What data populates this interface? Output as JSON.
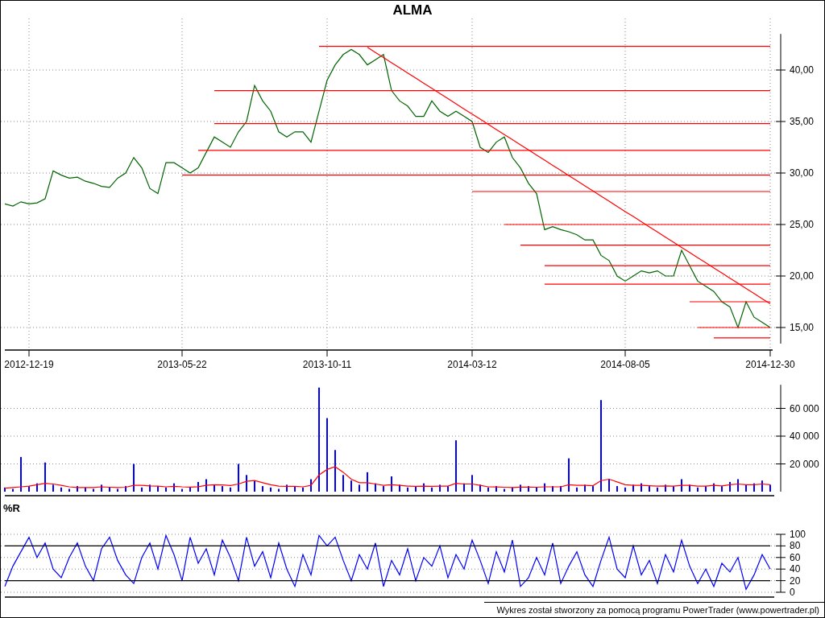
{
  "title": "ALMA",
  "price_chart": {
    "chart_data": {
      "type": "line",
      "categories": [
        null,
        null,
        null,
        "2012-12-19",
        null,
        null,
        null,
        null,
        null,
        null,
        null,
        null,
        null,
        null,
        null,
        null,
        null,
        null,
        null,
        null,
        null,
        null,
        "2013-05-22",
        null,
        null,
        null,
        null,
        null,
        null,
        null,
        null,
        null,
        null,
        null,
        null,
        null,
        null,
        null,
        null,
        null,
        "2013-10-11",
        null,
        null,
        null,
        null,
        null,
        null,
        null,
        null,
        null,
        null,
        null,
        null,
        null,
        null,
        null,
        null,
        null,
        "2014-03-12",
        null,
        null,
        null,
        null,
        null,
        null,
        null,
        null,
        null,
        null,
        null,
        null,
        null,
        null,
        null,
        null,
        null,
        null,
        "2014-08-05",
        null,
        null,
        null,
        null,
        null,
        null,
        null,
        null,
        null,
        null,
        null,
        null,
        null,
        null,
        null,
        null,
        null,
        "2014-12-30"
      ],
      "series": [
        {
          "color": "#006400",
          "values": [
            27,
            26.8,
            27.2,
            27,
            27.1,
            27.5,
            30.2,
            29.8,
            29.5,
            29.6,
            29.2,
            29,
            28.7,
            28.6,
            29.5,
            30,
            31.5,
            30.5,
            28.5,
            28,
            31,
            31,
            30.5,
            30,
            30.5,
            32,
            33.5,
            33,
            32.5,
            34,
            35,
            38.5,
            37,
            36,
            34,
            33.5,
            34,
            34,
            33,
            36,
            39,
            40.5,
            41.5,
            42,
            41.5,
            40.5,
            41,
            41.5,
            38,
            37,
            36.5,
            35.5,
            35.5,
            37,
            36,
            35.5,
            36,
            35.5,
            35,
            32.5,
            32,
            33,
            33.5,
            31.5,
            30.5,
            29,
            28,
            24.5,
            24.8,
            24.5,
            24.3,
            24,
            23.5,
            23.5,
            22,
            21.5,
            20,
            19.5,
            20,
            20.5,
            20.3,
            20.5,
            20,
            20,
            22.5,
            21,
            19.5,
            19,
            18.5,
            17.5,
            17,
            15,
            17.5,
            16,
            15.5,
            15
          ]
        },
        {
          "color": "#ff0000",
          "values": [
            null,
            null,
            null,
            null,
            null,
            null,
            null,
            null,
            null,
            null,
            null,
            null,
            null,
            null,
            null,
            null,
            null,
            null,
            null,
            null,
            null,
            null,
            null,
            null,
            null,
            null,
            null,
            null,
            null,
            null,
            null,
            null,
            null,
            null,
            null,
            null,
            null,
            null,
            null,
            42.3,
            42.3,
            42.3,
            42.3,
            42.3,
            42.3,
            42.3,
            42.3,
            42.3,
            42.3,
            42.3,
            42.3,
            42.3,
            42.3,
            42.3,
            42.3,
            42.3,
            42.3,
            42.3,
            42.3,
            42.3,
            42.3,
            42.3,
            42.3,
            42.3,
            42.3,
            42.3,
            42.3,
            42.3,
            42.3,
            42.3,
            42.3,
            42.3,
            42.3,
            42.3,
            42.3,
            42.3,
            42.3,
            42.3,
            42.3,
            42.3,
            42.3,
            42.3,
            42.3,
            42.3,
            42.3,
            42.3,
            42.3,
            42.3,
            42.3,
            42.3,
            42.3,
            42.3,
            42.3,
            42.3,
            42.3,
            42.3
          ]
        },
        {
          "color": "#ff0000",
          "values": [
            null,
            null,
            null,
            null,
            null,
            null,
            null,
            null,
            null,
            null,
            null,
            null,
            null,
            null,
            null,
            null,
            null,
            null,
            null,
            null,
            null,
            null,
            null,
            null,
            null,
            null,
            38,
            38,
            38,
            38,
            38,
            38,
            38,
            38,
            38,
            38,
            38,
            38,
            38,
            38,
            38,
            38,
            38,
            38,
            38,
            38,
            38,
            38,
            38,
            38,
            38,
            38,
            38,
            38,
            38,
            38,
            38,
            38,
            38,
            38,
            38,
            38,
            38,
            38,
            38,
            38,
            38,
            38,
            38,
            38,
            38,
            38,
            38,
            38,
            38,
            38,
            38,
            38,
            38,
            38,
            38,
            38,
            38,
            38,
            38,
            38,
            38,
            38,
            38,
            38,
            38,
            38,
            38,
            38,
            38,
            38
          ]
        },
        {
          "color": "#ff0000",
          "values": [
            null,
            null,
            null,
            null,
            null,
            null,
            null,
            null,
            null,
            null,
            null,
            null,
            null,
            null,
            null,
            null,
            null,
            null,
            null,
            null,
            null,
            null,
            null,
            null,
            null,
            null,
            34.8,
            34.8,
            34.8,
            34.8,
            34.8,
            34.8,
            34.8,
            34.8,
            34.8,
            34.8,
            34.8,
            34.8,
            34.8,
            34.8,
            34.8,
            34.8,
            34.8,
            34.8,
            34.8,
            34.8,
            34.8,
            34.8,
            34.8,
            34.8,
            34.8,
            34.8,
            34.8,
            34.8,
            34.8,
            34.8,
            34.8,
            34.8,
            34.8,
            34.8,
            34.8,
            34.8,
            34.8,
            34.8,
            34.8,
            34.8,
            34.8,
            34.8,
            34.8,
            34.8,
            34.8,
            34.8,
            34.8,
            34.8,
            34.8,
            34.8,
            34.8,
            34.8,
            34.8,
            34.8,
            34.8,
            34.8,
            34.8,
            34.8,
            34.8,
            34.8,
            34.8,
            34.8,
            34.8,
            34.8,
            34.8,
            34.8,
            34.8,
            34.8,
            34.8,
            34.8
          ]
        },
        {
          "color": "#ff0000",
          "values": [
            null,
            null,
            null,
            null,
            null,
            null,
            null,
            null,
            null,
            null,
            null,
            null,
            null,
            null,
            null,
            null,
            null,
            null,
            null,
            null,
            null,
            null,
            null,
            null,
            32.2,
            32.2,
            32.2,
            32.2,
            32.2,
            32.2,
            32.2,
            32.2,
            32.2,
            32.2,
            32.2,
            32.2,
            32.2,
            32.2,
            32.2,
            32.2,
            32.2,
            32.2,
            32.2,
            32.2,
            32.2,
            32.2,
            32.2,
            32.2,
            32.2,
            32.2,
            32.2,
            32.2,
            32.2,
            32.2,
            32.2,
            32.2,
            32.2,
            32.2,
            32.2,
            32.2,
            32.2,
            32.2,
            32.2,
            32.2,
            32.2,
            32.2,
            32.2,
            32.2,
            32.2,
            32.2,
            32.2,
            32.2,
            32.2,
            32.2,
            32.2,
            32.2,
            32.2,
            32.2,
            32.2,
            32.2,
            32.2,
            32.2,
            32.2,
            32.2,
            32.2,
            32.2,
            32.2,
            32.2,
            32.2,
            32.2,
            32.2,
            32.2,
            32.2,
            32.2,
            32.2,
            32.2
          ]
        },
        {
          "color": "#ff0000",
          "values": [
            null,
            null,
            null,
            null,
            null,
            null,
            null,
            null,
            null,
            null,
            null,
            null,
            null,
            null,
            null,
            null,
            null,
            null,
            null,
            null,
            null,
            null,
            29.8,
            29.8,
            29.8,
            29.8,
            29.8,
            29.8,
            29.8,
            29.8,
            29.8,
            29.8,
            29.8,
            29.8,
            29.8,
            29.8,
            29.8,
            29.8,
            29.8,
            29.8,
            29.8,
            29.8,
            29.8,
            29.8,
            29.8,
            29.8,
            29.8,
            29.8,
            29.8,
            29.8,
            29.8,
            29.8,
            29.8,
            29.8,
            29.8,
            29.8,
            29.8,
            29.8,
            29.8,
            29.8,
            29.8,
            29.8,
            29.8,
            29.8,
            29.8,
            29.8,
            29.8,
            29.8,
            29.8,
            29.8,
            29.8,
            29.8,
            29.8,
            29.8,
            29.8,
            29.8,
            29.8,
            29.8,
            29.8,
            29.8,
            29.8,
            29.8,
            29.8,
            29.8,
            29.8,
            29.8,
            29.8,
            29.8,
            29.8,
            29.8,
            29.8,
            29.8,
            29.8,
            29.8,
            29.8,
            29.8
          ]
        },
        {
          "color": "#ff0000",
          "values": [
            null,
            null,
            null,
            null,
            null,
            null,
            null,
            null,
            null,
            null,
            null,
            null,
            null,
            null,
            null,
            null,
            null,
            null,
            null,
            null,
            null,
            null,
            null,
            null,
            null,
            null,
            null,
            null,
            null,
            null,
            null,
            null,
            null,
            null,
            null,
            null,
            null,
            null,
            null,
            null,
            null,
            null,
            null,
            null,
            null,
            null,
            null,
            null,
            null,
            null,
            null,
            null,
            null,
            null,
            null,
            null,
            null,
            null,
            28.2,
            28.2,
            28.2,
            28.2,
            28.2,
            28.2,
            28.2,
            28.2,
            28.2,
            28.2,
            28.2,
            28.2,
            28.2,
            28.2,
            28.2,
            28.2,
            28.2,
            28.2,
            28.2,
            28.2,
            28.2,
            28.2,
            28.2,
            28.2,
            28.2,
            28.2,
            28.2,
            28.2,
            28.2,
            28.2,
            28.2,
            28.2,
            28.2,
            28.2,
            28.2,
            28.2,
            28.2,
            28.2
          ]
        },
        {
          "color": "#ff0000",
          "values": [
            null,
            null,
            null,
            null,
            null,
            null,
            null,
            null,
            null,
            null,
            null,
            null,
            null,
            null,
            null,
            null,
            null,
            null,
            null,
            null,
            null,
            null,
            null,
            null,
            null,
            null,
            null,
            null,
            null,
            null,
            null,
            null,
            null,
            null,
            null,
            null,
            null,
            null,
            null,
            null,
            null,
            null,
            null,
            null,
            null,
            null,
            null,
            null,
            null,
            null,
            null,
            null,
            null,
            null,
            null,
            null,
            null,
            null,
            null,
            null,
            null,
            null,
            25,
            25,
            25,
            25,
            25,
            25,
            25,
            25,
            25,
            25,
            25,
            25,
            25,
            25,
            25,
            25,
            25,
            25,
            25,
            25,
            25,
            25,
            25,
            25,
            25,
            25,
            25,
            25,
            25,
            25,
            25,
            25,
            25,
            25
          ]
        },
        {
          "color": "#ff0000",
          "values": [
            null,
            null,
            null,
            null,
            null,
            null,
            null,
            null,
            null,
            null,
            null,
            null,
            null,
            null,
            null,
            null,
            null,
            null,
            null,
            null,
            null,
            null,
            null,
            null,
            null,
            null,
            null,
            null,
            null,
            null,
            null,
            null,
            null,
            null,
            null,
            null,
            null,
            null,
            null,
            null,
            null,
            null,
            null,
            null,
            null,
            null,
            null,
            null,
            null,
            null,
            null,
            null,
            null,
            null,
            null,
            null,
            null,
            null,
            null,
            null,
            null,
            null,
            null,
            null,
            23,
            23,
            23,
            23,
            23,
            23,
            23,
            23,
            23,
            23,
            23,
            23,
            23,
            23,
            23,
            23,
            23,
            23,
            23,
            23,
            23,
            23,
            23,
            23,
            23,
            23,
            23,
            23,
            23,
            23,
            23,
            23
          ]
        },
        {
          "color": "#ff0000",
          "values": [
            null,
            null,
            null,
            null,
            null,
            null,
            null,
            null,
            null,
            null,
            null,
            null,
            null,
            null,
            null,
            null,
            null,
            null,
            null,
            null,
            null,
            null,
            null,
            null,
            null,
            null,
            null,
            null,
            null,
            null,
            null,
            null,
            null,
            null,
            null,
            null,
            null,
            null,
            null,
            null,
            null,
            null,
            null,
            null,
            null,
            null,
            null,
            null,
            null,
            null,
            null,
            null,
            null,
            null,
            null,
            null,
            null,
            null,
            null,
            null,
            null,
            null,
            null,
            null,
            null,
            null,
            null,
            21,
            21,
            21,
            21,
            21,
            21,
            21,
            21,
            21,
            21,
            21,
            21,
            21,
            21,
            21,
            21,
            21,
            21,
            21,
            21,
            21,
            21,
            21,
            21,
            21,
            21,
            21,
            21,
            21
          ]
        },
        {
          "color": "#ff0000",
          "values": [
            null,
            null,
            null,
            null,
            null,
            null,
            null,
            null,
            null,
            null,
            null,
            null,
            null,
            null,
            null,
            null,
            null,
            null,
            null,
            null,
            null,
            null,
            null,
            null,
            null,
            null,
            null,
            null,
            null,
            null,
            null,
            null,
            null,
            null,
            null,
            null,
            null,
            null,
            null,
            null,
            null,
            null,
            null,
            null,
            null,
            null,
            null,
            null,
            null,
            null,
            null,
            null,
            null,
            null,
            null,
            null,
            null,
            null,
            null,
            null,
            null,
            null,
            null,
            null,
            null,
            null,
            null,
            19.2,
            19.2,
            19.2,
            19.2,
            19.2,
            19.2,
            19.2,
            19.2,
            19.2,
            19.2,
            19.2,
            19.2,
            19.2,
            19.2,
            19.2,
            19.2,
            19.2,
            19.2,
            19.2,
            19.2,
            19.2,
            19.2,
            19.2,
            19.2,
            19.2,
            19.2,
            19.2,
            19.2,
            19.2
          ]
        },
        {
          "color": "#ff0000",
          "values": [
            null,
            null,
            null,
            null,
            null,
            null,
            null,
            null,
            null,
            null,
            null,
            null,
            null,
            null,
            null,
            null,
            null,
            null,
            null,
            null,
            null,
            null,
            null,
            null,
            null,
            null,
            null,
            null,
            null,
            null,
            null,
            null,
            null,
            null,
            null,
            null,
            null,
            null,
            null,
            null,
            null,
            null,
            null,
            null,
            null,
            null,
            null,
            null,
            null,
            null,
            null,
            null,
            null,
            null,
            null,
            null,
            null,
            null,
            null,
            null,
            null,
            null,
            null,
            null,
            null,
            null,
            null,
            null,
            null,
            null,
            null,
            null,
            null,
            null,
            null,
            null,
            null,
            null,
            null,
            null,
            null,
            null,
            null,
            null,
            null,
            17.5,
            17.5,
            17.5,
            17.5,
            17.5,
            17.5,
            17.5,
            17.5,
            17.5,
            17.5,
            17.5
          ]
        },
        {
          "color": "#ff0000",
          "values": [
            null,
            null,
            null,
            null,
            null,
            null,
            null,
            null,
            null,
            null,
            null,
            null,
            null,
            null,
            null,
            null,
            null,
            null,
            null,
            null,
            null,
            null,
            null,
            null,
            null,
            null,
            null,
            null,
            null,
            null,
            null,
            null,
            null,
            null,
            null,
            null,
            null,
            null,
            null,
            null,
            null,
            null,
            null,
            null,
            null,
            null,
            null,
            null,
            null,
            null,
            null,
            null,
            null,
            null,
            null,
            null,
            null,
            null,
            null,
            null,
            null,
            null,
            null,
            null,
            null,
            null,
            null,
            null,
            null,
            null,
            null,
            null,
            null,
            null,
            null,
            null,
            null,
            null,
            null,
            null,
            null,
            null,
            null,
            null,
            null,
            null,
            15,
            15,
            15,
            15,
            15,
            15,
            15,
            15,
            15,
            15
          ]
        },
        {
          "color": "#ff0000",
          "values": [
            null,
            null,
            null,
            null,
            null,
            null,
            null,
            null,
            null,
            null,
            null,
            null,
            null,
            null,
            null,
            null,
            null,
            null,
            null,
            null,
            null,
            null,
            null,
            null,
            null,
            null,
            null,
            null,
            null,
            null,
            null,
            null,
            null,
            null,
            null,
            null,
            null,
            null,
            null,
            null,
            null,
            null,
            null,
            null,
            null,
            null,
            null,
            null,
            null,
            null,
            null,
            null,
            null,
            null,
            null,
            null,
            null,
            null,
            null,
            null,
            null,
            null,
            null,
            null,
            null,
            null,
            null,
            null,
            null,
            null,
            null,
            null,
            null,
            null,
            null,
            null,
            null,
            null,
            null,
            null,
            null,
            null,
            null,
            null,
            null,
            null,
            null,
            null,
            14,
            14,
            14,
            14,
            14,
            14,
            14,
            14
          ]
        },
        {
          "color": "#ff0000",
          "values": [
            null,
            null,
            null,
            null,
            null,
            null,
            null,
            null,
            null,
            null,
            null,
            null,
            null,
            null,
            null,
            null,
            null,
            null,
            null,
            null,
            null,
            null,
            null,
            null,
            null,
            null,
            null,
            null,
            null,
            null,
            null,
            null,
            null,
            null,
            null,
            null,
            null,
            null,
            null,
            null,
            null,
            null,
            null,
            null,
            null,
            42.2,
            41.7,
            41.2,
            40.71,
            40.21,
            39.71,
            39.21,
            38.71,
            38.22,
            37.72,
            37.22,
            36.72,
            36.22,
            35.73,
            35.23,
            34.73,
            34.23,
            33.73,
            33.24,
            32.74,
            32.24,
            31.74,
            31.24,
            30.75,
            30.25,
            29.75,
            29.25,
            28.75,
            28.26,
            27.76,
            27.26,
            26.76,
            26.26,
            25.77,
            25.27,
            24.77,
            24.27,
            23.77,
            23.28,
            22.78,
            22.28,
            21.78,
            21.28,
            20.79,
            20.29,
            19.79,
            19.29,
            18.79,
            18.3,
            17.8,
            17.3
          ]
        }
      ],
      "ylim": [
        13,
        43.5
      ],
      "grid": true,
      "yticks": [
        {
          "value": 15,
          "label": "15,00"
        },
        {
          "value": 20,
          "label": "20,00"
        },
        {
          "value": 25,
          "label": "25,00"
        },
        {
          "value": 30,
          "label": "30,00"
        },
        {
          "value": 35,
          "label": "35,00"
        },
        {
          "value": 40,
          "label": "40,00"
        }
      ]
    }
  },
  "volume_chart": {
    "chart_data": {
      "type": "bar",
      "grid": true,
      "series": [
        {
          "color": "#0000ff",
          "values": [
            3000,
            2000,
            25000,
            4000,
            6000,
            21000,
            5000,
            3000,
            2000,
            4000,
            3000,
            2000,
            5000,
            3000,
            2000,
            4000,
            20000,
            3000,
            5000,
            4000,
            3000,
            6000,
            2000,
            3000,
            7000,
            9000,
            5000,
            4000,
            3000,
            20000,
            12000,
            8000,
            4000,
            3000,
            2000,
            5000,
            4000,
            3000,
            9000,
            75000,
            53000,
            30000,
            12000,
            8000,
            5000,
            14000,
            6000,
            4000,
            11000,
            5000,
            3000,
            4000,
            6000,
            3000,
            5000,
            4000,
            37000,
            6000,
            12000,
            5000,
            3000,
            4000,
            2000,
            3000,
            5000,
            4000,
            3000,
            6000,
            4000,
            4000,
            24000,
            3000,
            5000,
            4000,
            66000,
            9000,
            4000,
            3000,
            5000,
            6000,
            4000,
            3000,
            5000,
            4000,
            9000,
            5000,
            3000,
            4000,
            6000,
            4000,
            7000,
            9000,
            5000,
            6000,
            8000,
            5000
          ]
        },
        {
          "type": "line",
          "color": "#ff0000",
          "values": [
            2500,
            3000,
            3500,
            4000,
            5000,
            6000,
            5500,
            4500,
            3500,
            3000,
            3000,
            3000,
            3500,
            3200,
            3000,
            3200,
            4500,
            4500,
            4200,
            4000,
            3500,
            3800,
            3500,
            3300,
            3600,
            4500,
            5000,
            4800,
            4400,
            5500,
            7500,
            8000,
            6500,
            5000,
            4000,
            3800,
            3800,
            3500,
            4500,
            12000,
            16000,
            18000,
            14000,
            9000,
            6500,
            6500,
            5500,
            4500,
            5000,
            4500,
            4000,
            3800,
            4000,
            3800,
            4000,
            4000,
            6000,
            5500,
            5500,
            4500,
            3500,
            3400,
            3200,
            3000,
            3300,
            3300,
            3200,
            3500,
            3500,
            3500,
            5000,
            4500,
            4500,
            4300,
            8000,
            9000,
            7000,
            5000,
            4500,
            4600,
            4300,
            4000,
            4200,
            4000,
            4500,
            4500,
            4000,
            4000,
            4500,
            4200,
            5000,
            5500,
            5000,
            5000,
            5500,
            5000
          ]
        }
      ],
      "ylim": [
        0,
        77000
      ],
      "yticks": [
        {
          "value": 20000,
          "label": "20 000"
        },
        {
          "value": 40000,
          "label": "40 000"
        },
        {
          "value": 60000,
          "label": "60 000"
        }
      ]
    }
  },
  "r_chart": {
    "chart_data": {
      "type": "line",
      "title": "%R",
      "grid": true,
      "series": [
        {
          "color": "#0000ff",
          "values": [
            10,
            45,
            70,
            95,
            60,
            85,
            40,
            25,
            60,
            85,
            45,
            20,
            75,
            95,
            55,
            30,
            15,
            60,
            85,
            40,
            98,
            65,
            20,
            95,
            50,
            75,
            30,
            90,
            60,
            20,
            95,
            45,
            70,
            25,
            85,
            40,
            10,
            65,
            30,
            98,
            80,
            95,
            55,
            20,
            65,
            40,
            85,
            10,
            55,
            30,
            75,
            20,
            60,
            45,
            80,
            25,
            65,
            40,
            90,
            55,
            15,
            70,
            35,
            90,
            10,
            25,
            60,
            30,
            85,
            15,
            45,
            70,
            30,
            10,
            55,
            95,
            40,
            25,
            80,
            30,
            55,
            15,
            65,
            35,
            90,
            45,
            15,
            40,
            10,
            50,
            35,
            60,
            5,
            30,
            65,
            40
          ]
        },
        {
          "color": "#000000",
          "values": [
            80,
            80,
            80,
            80,
            80,
            80,
            80,
            80,
            80,
            80,
            80,
            80,
            80,
            80,
            80,
            80,
            80,
            80,
            80,
            80,
            80,
            80,
            80,
            80,
            80,
            80,
            80,
            80,
            80,
            80,
            80,
            80,
            80,
            80,
            80,
            80,
            80,
            80,
            80,
            80,
            80,
            80,
            80,
            80,
            80,
            80,
            80,
            80,
            80,
            80,
            80,
            80,
            80,
            80,
            80,
            80,
            80,
            80,
            80,
            80,
            80,
            80,
            80,
            80,
            80,
            80,
            80,
            80,
            80,
            80,
            80,
            80,
            80,
            80,
            80,
            80,
            80,
            80,
            80,
            80,
            80,
            80,
            80,
            80,
            80,
            80,
            80,
            80,
            80,
            80,
            80,
            80,
            80,
            80,
            80,
            80
          ]
        },
        {
          "color": "#000000",
          "values": [
            20,
            20,
            20,
            20,
            20,
            20,
            20,
            20,
            20,
            20,
            20,
            20,
            20,
            20,
            20,
            20,
            20,
            20,
            20,
            20,
            20,
            20,
            20,
            20,
            20,
            20,
            20,
            20,
            20,
            20,
            20,
            20,
            20,
            20,
            20,
            20,
            20,
            20,
            20,
            20,
            20,
            20,
            20,
            20,
            20,
            20,
            20,
            20,
            20,
            20,
            20,
            20,
            20,
            20,
            20,
            20,
            20,
            20,
            20,
            20,
            20,
            20,
            20,
            20,
            20,
            20,
            20,
            20,
            20,
            20,
            20,
            20,
            20,
            20,
            20,
            20,
            20,
            20,
            20,
            20,
            20,
            20,
            20,
            20,
            20,
            20,
            20,
            20,
            20,
            20,
            20,
            20,
            20,
            20,
            20,
            20
          ]
        }
      ],
      "ylim": [
        0,
        100
      ],
      "yticks": [
        0,
        20,
        40,
        60,
        80,
        100
      ]
    }
  },
  "footer": "Wykres został stworzony za pomocą programu PowerTrader (www.powertrader.pl)"
}
